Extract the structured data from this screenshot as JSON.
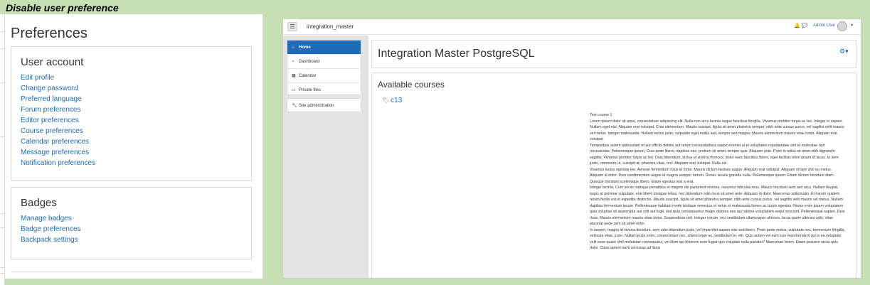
{
  "caption": "Disable user preference",
  "left_panel": {
    "title": "Preferences",
    "user_account": {
      "heading": "User account",
      "links": [
        "Edit profile",
        "Change password",
        "Preferred language",
        "Forum preferences",
        "Editor preferences",
        "Course preferences",
        "Calendar preferences",
        "Message preferences",
        "Notification preferences"
      ]
    },
    "badges": {
      "heading": "Badges",
      "links": [
        "Manage badges",
        "Badge preferences",
        "Backpack settings"
      ]
    }
  },
  "right_panel": {
    "navbar": {
      "menu_icon": "hamburger-icon",
      "site_name": "integration_master",
      "user_name": "Admin User",
      "icons": [
        "bell-icon",
        "chat-icon"
      ]
    },
    "sidebar": {
      "items": [
        {
          "label": "Home",
          "icon": "home-icon",
          "active": true
        },
        {
          "label": "Dashboard",
          "icon": "dashboard-icon",
          "active": false
        },
        {
          "label": "Calendar",
          "icon": "calendar-icon",
          "active": false
        },
        {
          "label": "Private files",
          "icon": "file-icon",
          "active": false
        }
      ],
      "admin": {
        "label": "Site administration",
        "icon": "wrench-icon"
      }
    },
    "header": {
      "title": "Integration Master PostgreSQL"
    },
    "content": {
      "heading": "Available courses",
      "course_link": "c13",
      "summary_title": "Test course 1",
      "summary_paragraphs": [
        "Lorem ipsum dolor sit amet, consectetuer adipiscing elit. Nulla non arcu lacinia neque faucibus fringilla. Vivamus porttitor turpis ac leo. Integer in sapien. Nullam eget nisl. Aliquam erat volutpat. Cras elementum. Mauris suscipit, ligula sit amet pharetra semper, nibh ante cursus purus, vel sagittis velit mauris vel metus. Integer malesuada. Nullam lectus justo, vulputate eget mollis sed, tempor sed magna. Mauris elementum mauris vitae tortor. Aliquam erat volutpat.",
        "Temporibus autem quibusdam et aut officiis debitis aut rerum necessitatibus saepe eveniet ut et voluptates repudiandae sint et molestiae non recusandae. Pellentesque ipsum. Cras pede libero, dapibus nec, pretium sit amet, tempor quis. Aliquam ante. Proin in tellus sit amet nibh dignissim sagittis. Vivamus porttitor turpis ac leo. Duis bibendum, lectus ut viverra rhoncus, dolor nunc faucibus libero, eget facilisis enim ipsum id lacus. In sem justo, commodo ut, suscipit at, pharetra vitae, orci. Aliquam erat volutpat. Nulla est.",
        "Vivamus luctus egestas leo. Aenean fermentum risus id tortor. Mauris dictum facilisis augue. Aliquam erat volutpat. Aliquam ornare wisi eu metus. Aliquam id dolor. Duis condimentum augue id magna semper rutrum. Donec iaculis gravida nulla. Pellentesque ipsum. Etiam dictum tincidunt diam. Quisque tincidunt scelerisque libero. Etiam egestas wisi a erat.",
        "Integer lacinia. Cum sociis natoque penatibus et magnis dis parturient montes, nascetur ridiculus mus. Mauris tincidunt sem sed arcu. Nullam feugiat, turpis at pulvinar vulputate, erat libero tristique tellus, nec bibendum odio risus sit amet ante. Aliquam id dolor. Maecenas sollicitudin. Et harum quidem rerum facilis est et expedita distinctio. Mauris suscipit, ligula sit amet pharetra semper, nibh ante cursus purus, vel sagittis velit mauris vel metus. Nullam dapibus fermentum ipsum. Pellentesque habitant morbi tristique senectus et netus et malesuada fames ac turpis egestas. Nemo enim ipsam voluptatem quia voluptas sit aspernatur aut odit aut fugit, sed quia consequuntur magni dolores eos qui ratione voluptatem sequi nesciunt. Pellentesque sapien. Duis risus. Mauris elementum mauris vitae tortor. Suspendisse nisl. Integer rutrum, orci vestibulum ullamcorper ultricies, lacus quam ultricies odio, vitae placerat pede sem sit amet enim.",
        "In laoreet, magna id viverra tincidunt, sem odio bibendum justo, vel imperdiet sapien wisi sed libero. Proin pede metus, vulputate nec, fermentum fringilla, vehicula vitae, justo. Nullam justo enim, consectetuer nec, ullamcorper ac, vestibulum in, elit. Quis autem vel eum iure reprehenderit qui in ea voluptate velit esse quam nihil molestiae consequatur, vel illum qui dolorem eum fugiat quo voluptas nulla pariatur? Maecenas lorem. Etiam posuere lacus quis dolor. Class aptent taciti sociosqu ad litora"
      ]
    }
  },
  "colors": {
    "link": "#1f6bb5",
    "active_nav": "#1f6bb5",
    "background": "#c6e0b4"
  }
}
